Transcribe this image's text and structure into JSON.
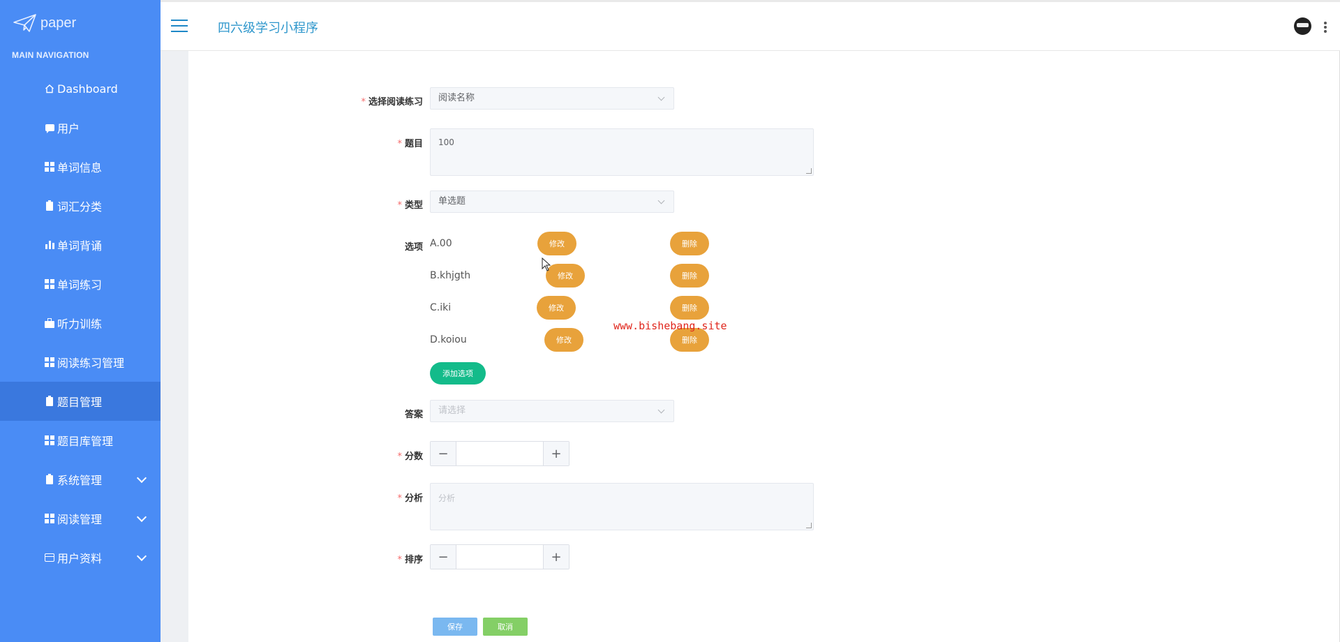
{
  "sidebar": {
    "logo_text": "paper",
    "nav_title": "MAIN NAVIGATION",
    "items": [
      {
        "label": "Dashboard",
        "icon": "home-icon"
      },
      {
        "label": "用户",
        "icon": "comment-icon"
      },
      {
        "label": "单词信息",
        "icon": "grid-icon"
      },
      {
        "label": "词汇分类",
        "icon": "clipboard-icon"
      },
      {
        "label": "单词背诵",
        "icon": "bar-chart-icon"
      },
      {
        "label": "单词练习",
        "icon": "grid-icon"
      },
      {
        "label": "听力训练",
        "icon": "briefcase-icon"
      },
      {
        "label": "阅读练习管理",
        "icon": "grid-icon"
      },
      {
        "label": "题目管理",
        "icon": "clipboard-icon",
        "active": true
      },
      {
        "label": "题目库管理",
        "icon": "grid-icon"
      },
      {
        "label": "系统管理",
        "icon": "clipboard-icon",
        "expandable": true
      },
      {
        "label": "阅读管理",
        "icon": "grid-icon",
        "expandable": true
      },
      {
        "label": "用户资料",
        "icon": "calendar-icon",
        "expandable": true
      }
    ]
  },
  "header": {
    "app_title": "四六级学习小程序"
  },
  "form": {
    "reading": {
      "label": "选择阅读练习",
      "value": "阅读名称"
    },
    "question": {
      "label": "题目",
      "value": "100"
    },
    "type": {
      "label": "类型",
      "value": "单选题"
    },
    "options": {
      "label": "选项",
      "items": [
        {
          "text": "A.00",
          "edit": "修改",
          "delete": "删除"
        },
        {
          "text": "B.khjgth",
          "edit": "修改",
          "delete": "删除"
        },
        {
          "text": "C.iki",
          "edit": "修改",
          "delete": "删除"
        },
        {
          "text": "D.koiou",
          "edit": "修改",
          "delete": "删除"
        }
      ],
      "add_label": "添加选项"
    },
    "answer": {
      "label": "答案",
      "placeholder": "请选择"
    },
    "score": {
      "label": "分数",
      "value": ""
    },
    "analysis": {
      "label": "分析",
      "placeholder": "分析"
    },
    "order": {
      "label": "排序",
      "value": ""
    },
    "save_label": "保存",
    "cancel_label": "取消"
  },
  "watermark": "www.bishebang.site",
  "colors": {
    "sidebar_bg": "#4a8cf5",
    "sidebar_active": "#3a78de",
    "title_color": "#2f97cc",
    "option_button": "#e8a23b",
    "add_button": "#13bb8a",
    "save_button": "#7ab8f0",
    "cancel_button": "#84cf66",
    "required_star": "#f56c6c",
    "watermark": "#e0261c"
  }
}
